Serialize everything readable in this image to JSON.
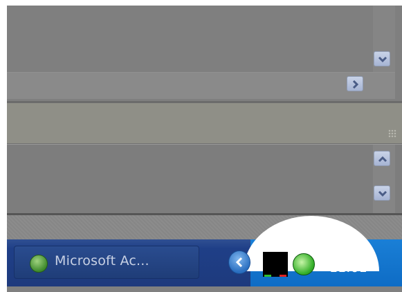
{
  "taskbar": {
    "task_button_label": "Microsoft Ac...",
    "clock": "11:01"
  },
  "icons": {
    "task_button_icon": "access-app-icon",
    "tray_expand": "chevron-left-icon",
    "tray_icon_1": "monitor-icon",
    "tray_icon_2": "network-globe-icon"
  },
  "colors": {
    "taskbar": "#1e3a7d",
    "tray": "#0e6cc5",
    "dimmed_overlay": "#808080"
  }
}
